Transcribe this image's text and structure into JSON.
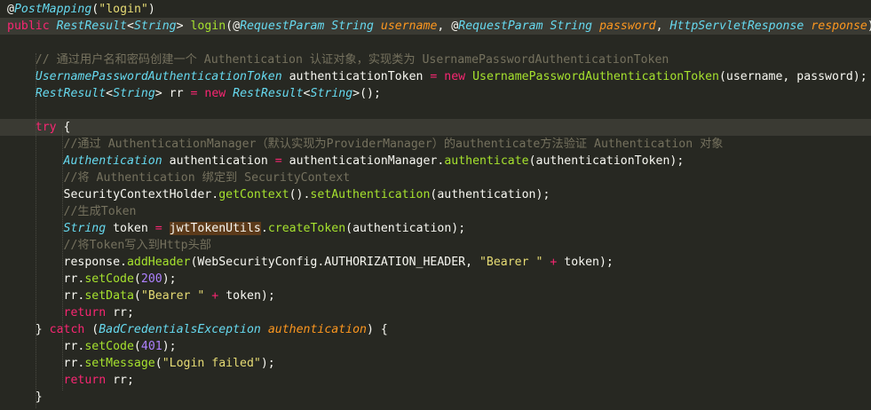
{
  "editor": {
    "theme": "monokai",
    "colors": {
      "background": "#272822",
      "current_line": "#3a3a33",
      "keyword": "#f92672",
      "type": "#66d9ef",
      "string": "#e6db74",
      "function": "#a6e22e",
      "number": "#ae81ff",
      "comment": "#75715e",
      "param": "#fd971f"
    },
    "lines": [
      [
        [
          "ann",
          "@"
        ],
        [
          "annname",
          "PostMapping"
        ],
        [
          "plain",
          "("
        ],
        [
          "str",
          "\"login\""
        ],
        [
          "plain",
          ")"
        ]
      ],
      [
        [
          "kw",
          "public "
        ],
        [
          "type",
          "RestResult"
        ],
        [
          "plain",
          "<"
        ],
        [
          "type",
          "String"
        ],
        [
          "plain",
          "> "
        ],
        [
          "fn",
          "login"
        ],
        [
          "plain",
          "(@"
        ],
        [
          "annname",
          "RequestParam"
        ],
        [
          "plain",
          " "
        ],
        [
          "type",
          "String"
        ],
        [
          "plain",
          " "
        ],
        [
          "param",
          "username"
        ],
        [
          "plain",
          ", @"
        ],
        [
          "annname",
          "RequestParam"
        ],
        [
          "plain",
          " "
        ],
        [
          "type",
          "String"
        ],
        [
          "plain",
          " "
        ],
        [
          "param",
          "password"
        ],
        [
          "plain",
          ", "
        ],
        [
          "type",
          "HttpServletResponse"
        ],
        [
          "plain",
          " "
        ],
        [
          "param",
          "response"
        ],
        [
          "plain",
          ") {"
        ]
      ],
      [],
      [
        [
          "plain",
          "    "
        ],
        [
          "cm",
          "// 通过用户名和密码创建一个 Authentication 认证对象，实现类为 UsernamePasswordAuthenticationToken"
        ]
      ],
      [
        [
          "plain",
          "    "
        ],
        [
          "type",
          "UsernamePasswordAuthenticationToken"
        ],
        [
          "plain",
          " authenticationToken "
        ],
        [
          "op",
          "="
        ],
        [
          "plain",
          " "
        ],
        [
          "kw",
          "new "
        ],
        [
          "fn",
          "UsernamePasswordAuthenticationToken"
        ],
        [
          "plain",
          "(username, password);"
        ]
      ],
      [
        [
          "plain",
          "    "
        ],
        [
          "type",
          "RestResult"
        ],
        [
          "plain",
          "<"
        ],
        [
          "type",
          "String"
        ],
        [
          "plain",
          "> rr "
        ],
        [
          "op",
          "="
        ],
        [
          "plain",
          " "
        ],
        [
          "kw",
          "new "
        ],
        [
          "type",
          "RestResult"
        ],
        [
          "plain",
          "<"
        ],
        [
          "type",
          "String"
        ],
        [
          "plain",
          ">();"
        ]
      ],
      [],
      [
        [
          "plain",
          "    "
        ],
        [
          "kw",
          "try "
        ],
        [
          "plain",
          "{"
        ]
      ],
      [
        [
          "plain",
          "        "
        ],
        [
          "cm",
          "//通过 AuthenticationManager（默认实现为ProviderManager）的authenticate方法验证 Authentication 对象"
        ]
      ],
      [
        [
          "plain",
          "        "
        ],
        [
          "type",
          "Authentication"
        ],
        [
          "plain",
          " authentication "
        ],
        [
          "op",
          "="
        ],
        [
          "plain",
          " authenticationManager."
        ],
        [
          "fn",
          "authenticate"
        ],
        [
          "plain",
          "(authenticationToken);"
        ]
      ],
      [
        [
          "plain",
          "        "
        ],
        [
          "cm",
          "//将 Authentication 绑定到 SecurityContext"
        ]
      ],
      [
        [
          "plain",
          "        SecurityContextHolder."
        ],
        [
          "fn",
          "getContext"
        ],
        [
          "plain",
          "()."
        ],
        [
          "fn",
          "setAuthentication"
        ],
        [
          "plain",
          "(authentication);"
        ]
      ],
      [
        [
          "plain",
          "        "
        ],
        [
          "cm",
          "//生成Token"
        ]
      ],
      [
        [
          "plain",
          "        "
        ],
        [
          "type",
          "String"
        ],
        [
          "plain",
          " token "
        ],
        [
          "op",
          "="
        ],
        [
          "plain",
          " "
        ],
        [
          "hl",
          "jwtTokenUtils"
        ],
        [
          "plain",
          "."
        ],
        [
          "fn",
          "createToken"
        ],
        [
          "plain",
          "(authentication);"
        ]
      ],
      [
        [
          "plain",
          "        "
        ],
        [
          "cm",
          "//将Token写入到Http头部"
        ]
      ],
      [
        [
          "plain",
          "        response."
        ],
        [
          "fn",
          "addHeader"
        ],
        [
          "plain",
          "(WebSecurityConfig.AUTHORIZATION_HEADER, "
        ],
        [
          "str",
          "\"Bearer \""
        ],
        [
          "plain",
          " "
        ],
        [
          "op",
          "+"
        ],
        [
          "plain",
          " token);"
        ]
      ],
      [
        [
          "plain",
          "        rr."
        ],
        [
          "fn",
          "setCode"
        ],
        [
          "plain",
          "("
        ],
        [
          "num",
          "200"
        ],
        [
          "plain",
          ");"
        ]
      ],
      [
        [
          "plain",
          "        rr."
        ],
        [
          "fn",
          "setData"
        ],
        [
          "plain",
          "("
        ],
        [
          "str",
          "\"Bearer \""
        ],
        [
          "plain",
          " "
        ],
        [
          "op",
          "+"
        ],
        [
          "plain",
          " token);"
        ]
      ],
      [
        [
          "plain",
          "        "
        ],
        [
          "kw",
          "return"
        ],
        [
          "plain",
          " rr;"
        ]
      ],
      [
        [
          "plain",
          "    } "
        ],
        [
          "kw",
          "catch"
        ],
        [
          "plain",
          " ("
        ],
        [
          "type",
          "BadCredentialsException"
        ],
        [
          "plain",
          " "
        ],
        [
          "param",
          "authentication"
        ],
        [
          "plain",
          ") {"
        ]
      ],
      [
        [
          "plain",
          "        rr."
        ],
        [
          "fn",
          "setCode"
        ],
        [
          "plain",
          "("
        ],
        [
          "num",
          "401"
        ],
        [
          "plain",
          ");"
        ]
      ],
      [
        [
          "plain",
          "        rr."
        ],
        [
          "fn",
          "setMessage"
        ],
        [
          "plain",
          "("
        ],
        [
          "str",
          "\"Login failed\""
        ],
        [
          "plain",
          ");"
        ]
      ],
      [
        [
          "plain",
          "        "
        ],
        [
          "kw",
          "return"
        ],
        [
          "plain",
          " rr;"
        ]
      ],
      [
        [
          "plain",
          "    }"
        ]
      ]
    ],
    "highlighted_lines": [
      1,
      7
    ]
  }
}
